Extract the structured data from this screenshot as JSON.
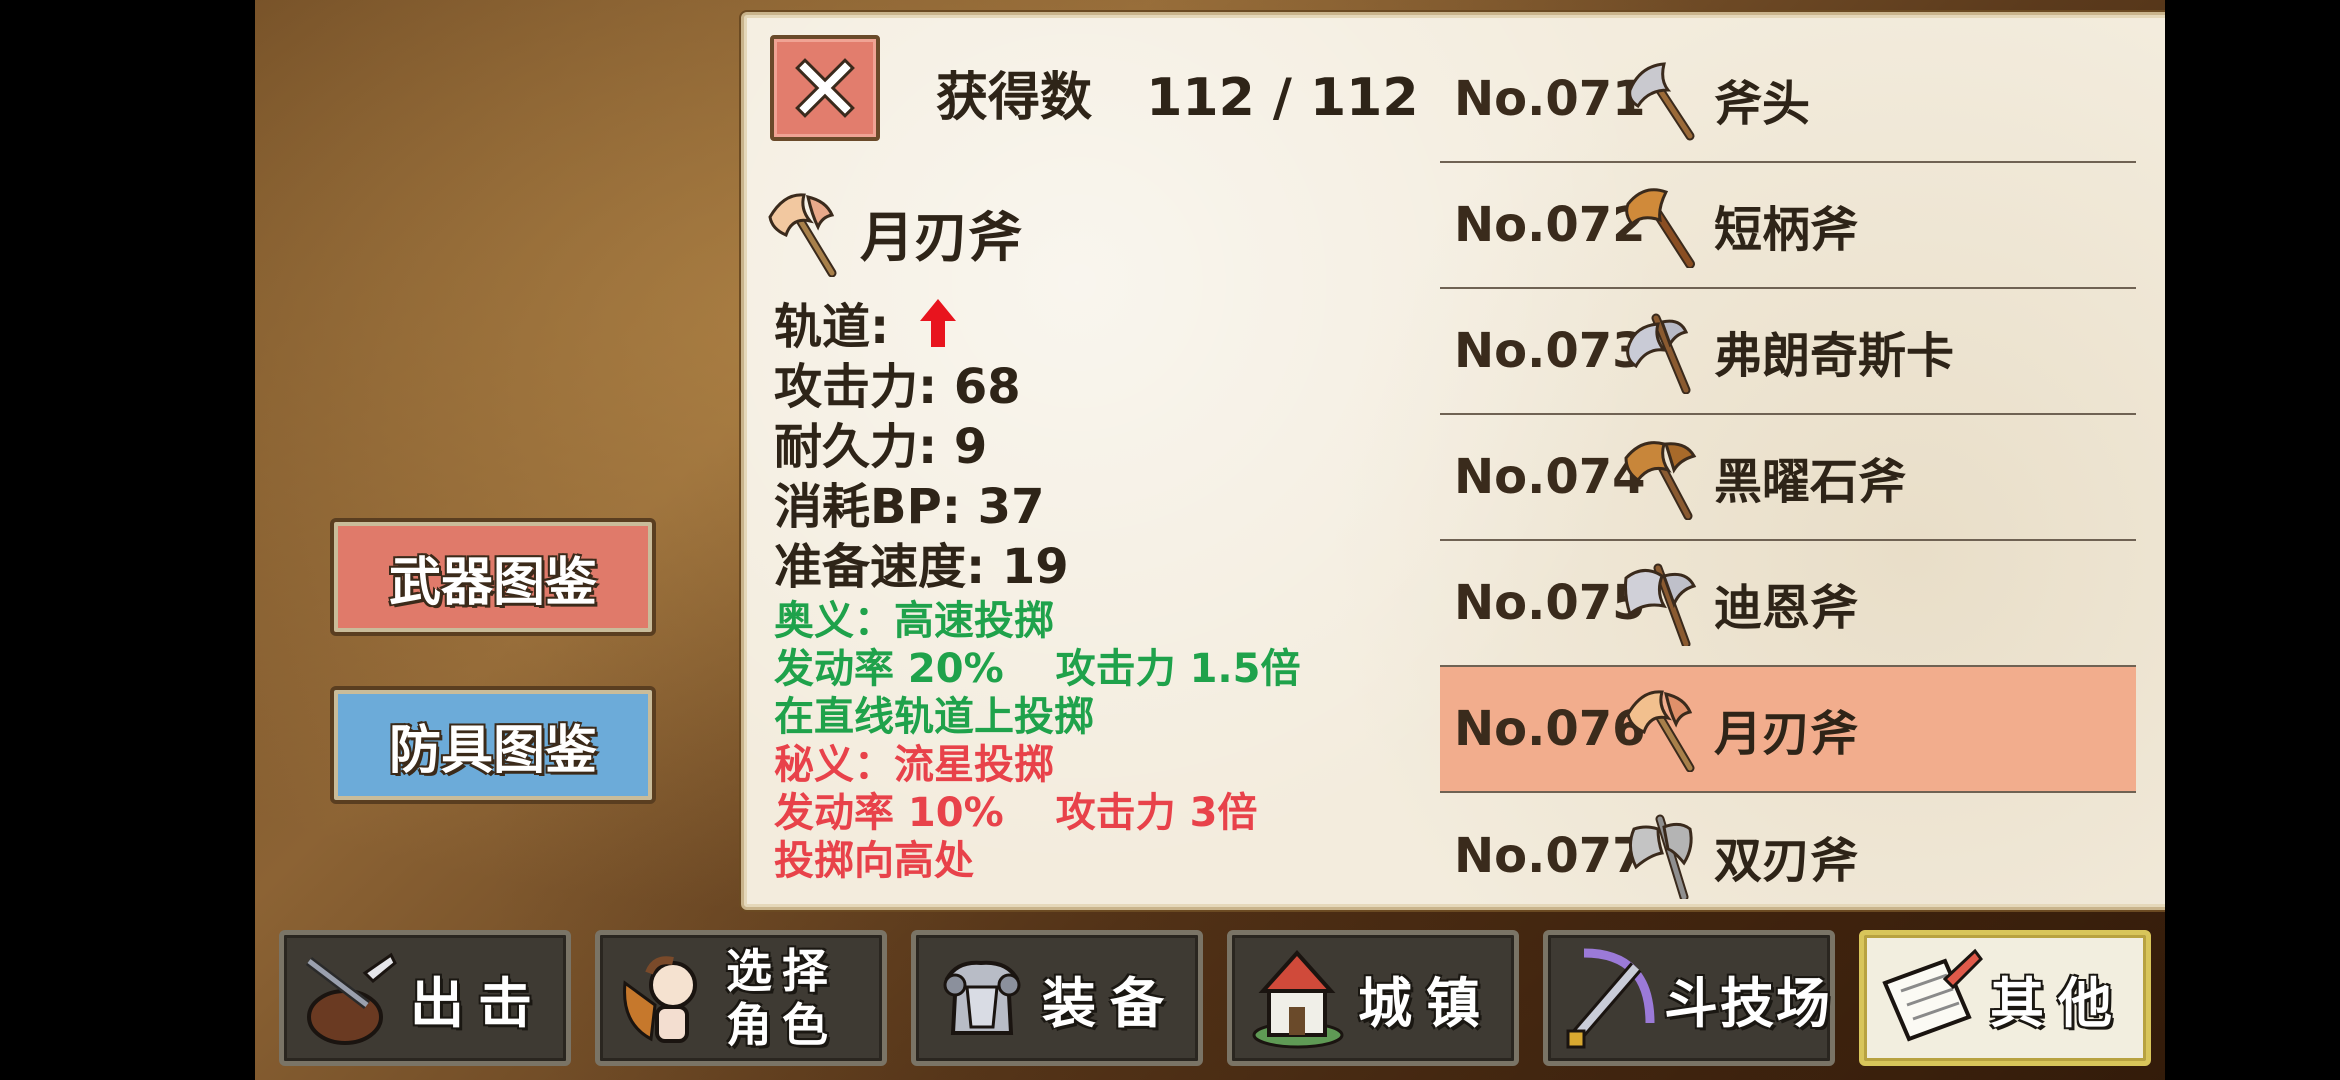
{
  "panel": {
    "obtained_label": "获得数",
    "obtained_value": "112 / 112",
    "close_icon": "close-icon"
  },
  "weapon": {
    "name": "月刃斧",
    "trajectory_label": "轨道:",
    "trajectory_icon": "up-arrow-icon",
    "trajectory_color": "#e8141e",
    "attack": "攻击力: 68",
    "durability": "耐久力: 9",
    "bp_cost": "消耗BP: 37",
    "ready_speed": "准备速度: 19",
    "skill_green": {
      "title": "奥义：高速投掷",
      "rate": "发动率 20%",
      "power": "攻击力 1.5倍",
      "desc": "在直线轨道上投掷",
      "color": "#1fa24b"
    },
    "skill_red": {
      "title": "秘义：流星投掷",
      "rate": "发动率 10%",
      "power": "攻击力 3倍",
      "desc": "投掷向高处",
      "color": "#e8424a"
    }
  },
  "list": [
    {
      "no": "No.071",
      "name": "斧头",
      "icon": "axe-icon"
    },
    {
      "no": "No.072",
      "name": "短柄斧",
      "icon": "short-axe-icon"
    },
    {
      "no": "No.073",
      "name": "弗朗奇斯卡",
      "icon": "francisca-icon"
    },
    {
      "no": "No.074",
      "name": "黑曜石斧",
      "icon": "obsidian-axe-icon"
    },
    {
      "no": "No.075",
      "name": "迪恩斧",
      "icon": "dane-axe-icon"
    },
    {
      "no": "No.076",
      "name": "月刃斧",
      "icon": "moon-axe-icon",
      "selected": true
    },
    {
      "no": "No.077",
      "name": "双刃斧",
      "icon": "double-axe-icon"
    }
  ],
  "side_buttons": {
    "weapon_catalog": "武器图鉴",
    "armor_catalog": "防具图鉴"
  },
  "nav": [
    {
      "label": "出击",
      "icon": "sortie-icon"
    },
    {
      "label_line1": "选择",
      "label_line2": "角色",
      "icon": "character-icon"
    },
    {
      "label": "装备",
      "icon": "armor-icon"
    },
    {
      "label": "城镇",
      "icon": "town-icon"
    },
    {
      "label": "斗技场",
      "icon": "arena-icon"
    },
    {
      "label": "其他",
      "icon": "scroll-icon",
      "active": true
    }
  ]
}
